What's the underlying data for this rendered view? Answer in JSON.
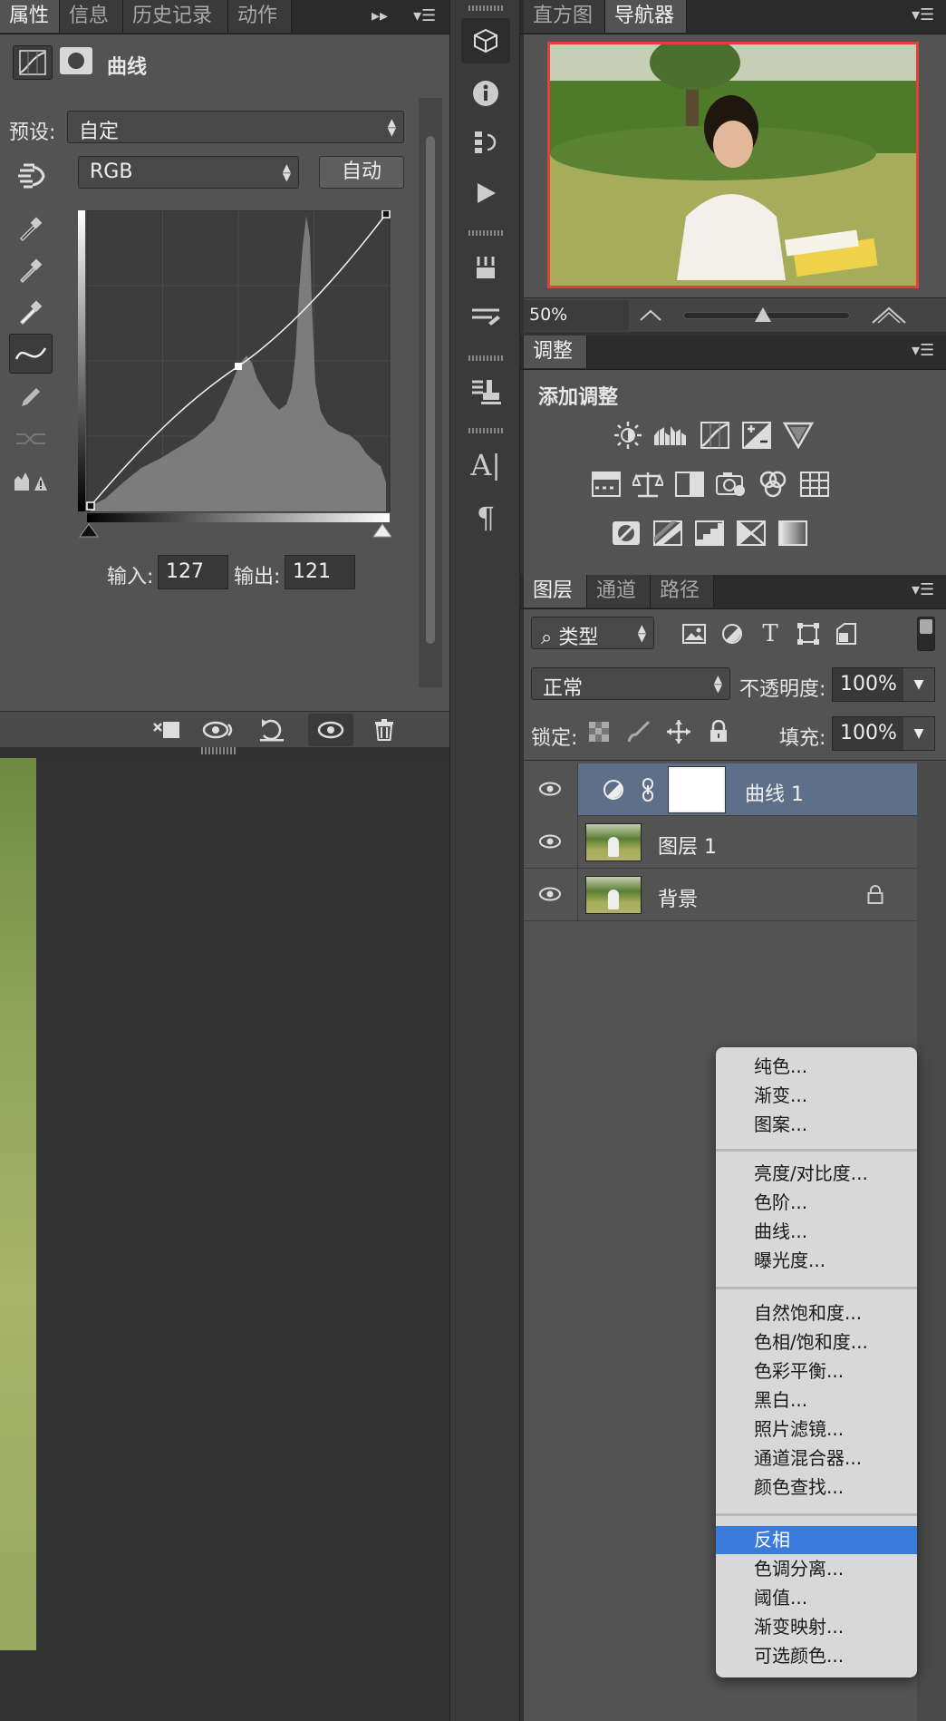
{
  "properties_panel": {
    "tabs": [
      "属性",
      "信息",
      "历史记录",
      "动作"
    ],
    "title": "曲线",
    "preset_label": "预设:",
    "preset_value": "自定",
    "channel_value": "RGB",
    "auto_label": "自动",
    "input_label": "输入:",
    "input_value": "127",
    "output_label": "输出:",
    "output_value": "121"
  },
  "navigator_panel": {
    "tabs": [
      "直方图",
      "导航器"
    ],
    "zoom": "50%"
  },
  "adjustments_panel": {
    "tab": "调整",
    "title": "添加调整"
  },
  "layers_panel": {
    "tabs": [
      "图层",
      "通道",
      "路径"
    ],
    "filter_kind": "类型",
    "blend_mode": "正常",
    "opacity_label": "不透明度:",
    "opacity_value": "100%",
    "lock_label": "锁定:",
    "fill_label": "填充:",
    "fill_value": "100%",
    "layers": [
      {
        "name": "曲线 1"
      },
      {
        "name": "图层 1"
      },
      {
        "name": "背景"
      }
    ]
  },
  "context_menu": {
    "groups": [
      [
        "纯色...",
        "渐变...",
        "图案..."
      ],
      [
        "亮度/对比度...",
        "色阶...",
        "曲线...",
        "曝光度..."
      ],
      [
        "自然饱和度...",
        "色相/饱和度...",
        "色彩平衡...",
        "黑白...",
        "照片滤镜...",
        "通道混合器...",
        "颜色查找..."
      ],
      [
        "反相",
        "色调分离...",
        "阈值...",
        "渐变映射...",
        "可选颜色..."
      ]
    ],
    "selected": "反相"
  },
  "colors": {
    "accent": "#3b7bdc",
    "panel": "#535353",
    "selected_layer": "#5e6f8a",
    "navigator_frame": "#e0413a"
  }
}
